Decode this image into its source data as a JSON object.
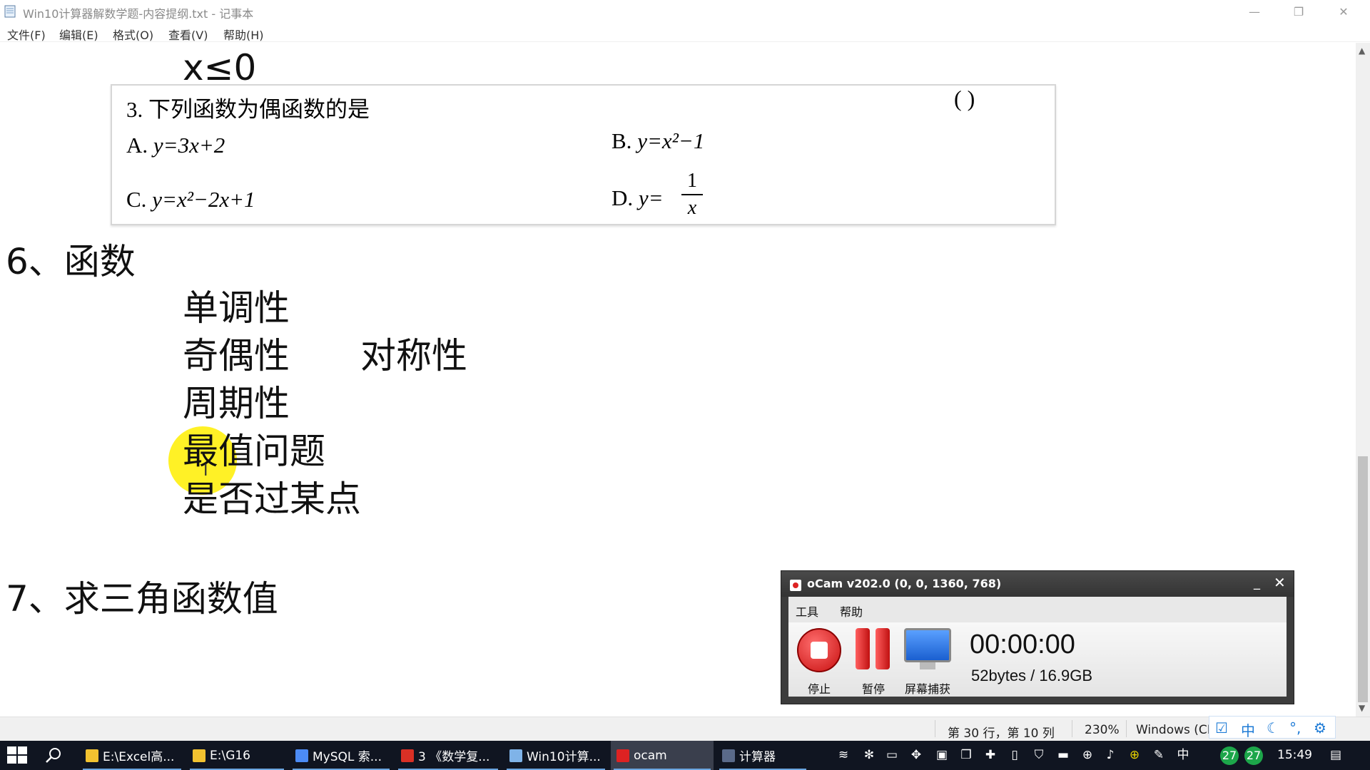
{
  "window": {
    "title": "Win10计算器解数学题-内容提纲.txt - 记事本",
    "minimize": "—",
    "maximize": "❐",
    "close": "✕"
  },
  "menu": {
    "file": "文件(F)",
    "edit": "编辑(E)",
    "format": "格式(O)",
    "view": "查看(V)",
    "help": "帮助(H)"
  },
  "doc": {
    "line_top": "x≤0",
    "question": {
      "title": "3. 下列函数为偶函数的是",
      "paren": "(        )",
      "a_prefix": "A. ",
      "a_expr": "y=3x+2",
      "b_prefix": "B. ",
      "b_expr": "y=x²−1",
      "c_prefix": "C. ",
      "c_expr": "y=x²−2x+1",
      "d_prefix": "D. ",
      "d_expr": "y=",
      "d_num": "1",
      "d_den": "x"
    },
    "section6": "6、函数",
    "item_monotonic": "单调性",
    "item_parity": "奇偶性",
    "item_symmetry": "对称性",
    "item_period": "周期性",
    "item_extreme": "最值问题",
    "item_point": "是否过某点",
    "section7": "7、求三角函数值"
  },
  "status": {
    "position": "第 30 行，第 10 列",
    "zoom": "230%",
    "encoding": "Windows (CR"
  },
  "ocam": {
    "title": "oCam v202.0 (0, 0, 1360, 768)",
    "menu_tools": "工具",
    "menu_help": "帮助",
    "stop": "停止",
    "pause": "暂停",
    "capture": "屏幕捕获",
    "timer": "00:00:00",
    "size": "52bytes / 16.9GB",
    "minimize": "_",
    "close": "✕"
  },
  "ime": {
    "mode": "中"
  },
  "taskbar": {
    "apps": [
      {
        "label": "E:\\Excel高...",
        "icon": "folder-icon",
        "color": "#f2c230"
      },
      {
        "label": "E:\\G16",
        "icon": "folder-icon",
        "color": "#f2c230"
      },
      {
        "label": "MySQL 索...",
        "icon": "chrome-icon",
        "color": "#4c8bf5"
      },
      {
        "label": "3 《数学复...",
        "icon": "wps-icon",
        "color": "#d93025"
      },
      {
        "label": "Win10计算...",
        "icon": "notepad-icon",
        "color": "#7fb3e8"
      },
      {
        "label": "ocam",
        "icon": "ocam-icon",
        "color": "#d22"
      },
      {
        "label": "计算器",
        "icon": "calculator-icon",
        "color": "#5a6a8a"
      }
    ],
    "ime_lang": "中",
    "badge1": "27",
    "badge2": "27",
    "clock": "15:49"
  }
}
